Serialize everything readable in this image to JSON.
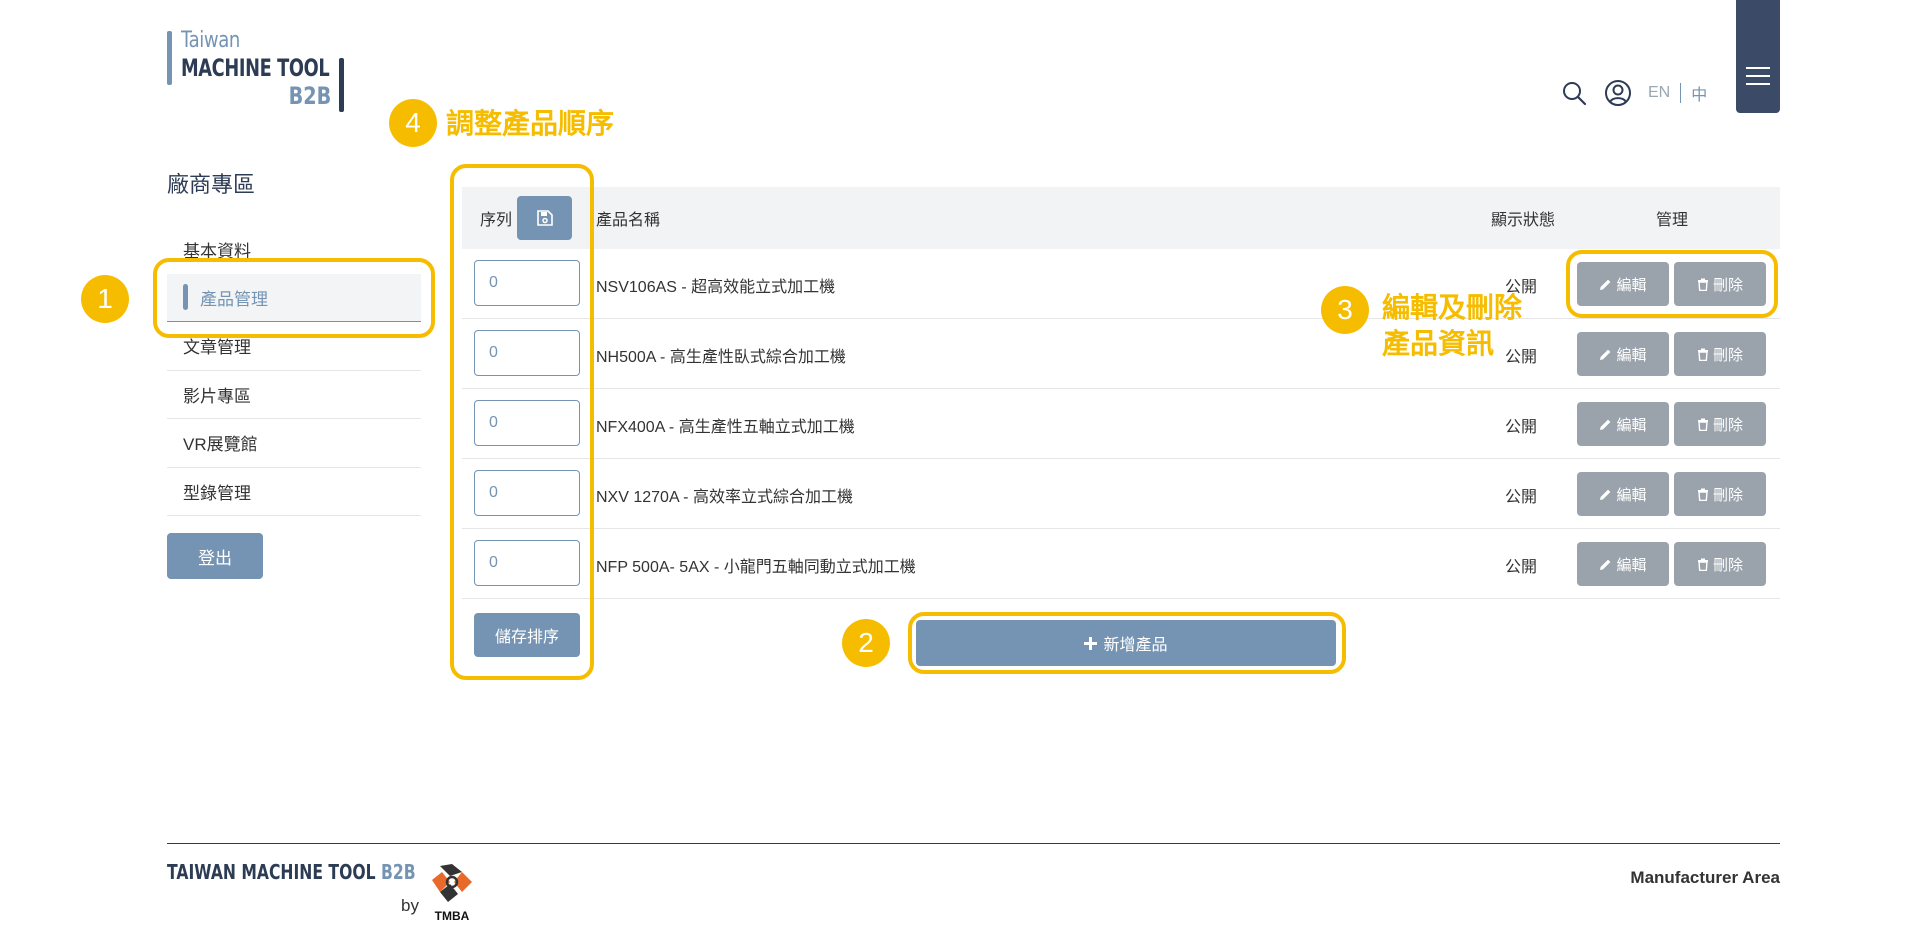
{
  "logo": {
    "line1": "Taiwan",
    "line2": "MACHINE TOOL",
    "line3": "B2B"
  },
  "header": {
    "lang_en": "EN",
    "lang_zh": "中",
    "search_icon": "search-icon",
    "user_icon": "user-icon",
    "menu_icon": "hamburger-menu-icon"
  },
  "sidebar": {
    "title": "廠商專區",
    "items": [
      {
        "label": "基本資料"
      },
      {
        "label": "產品管理",
        "active": true
      },
      {
        "label": "文章管理"
      },
      {
        "label": "影片專區"
      },
      {
        "label": "VR展覽館"
      },
      {
        "label": "型錄管理"
      }
    ],
    "logout": "登出"
  },
  "table": {
    "headers": {
      "seq": "序列",
      "name": "產品名稱",
      "status": "顯示狀態",
      "manage": "管理"
    },
    "rows": [
      {
        "seq": "0",
        "name": "NSV106AS - 超高效能立式加工機",
        "status": "公開",
        "edit": "編輯",
        "delete": "刪除"
      },
      {
        "seq": "0",
        "name": "NH500A - 高生產性臥式綜合加工機",
        "status": "公開",
        "edit": "編輯",
        "delete": "刪除"
      },
      {
        "seq": "0",
        "name": "NFX400A - 高生產性五軸立式加工機",
        "status": "公開",
        "edit": "編輯",
        "delete": "刪除"
      },
      {
        "seq": "0",
        "name": "NXV 1270A - 高效率立式綜合加工機",
        "status": "公開",
        "edit": "編輯",
        "delete": "刪除"
      },
      {
        "seq": "0",
        "name": "NFP 500A- 5AX - 小龍門五軸同動立式加工機",
        "status": "公開",
        "edit": "編輯",
        "delete": "刪除"
      }
    ],
    "save_order": "儲存排序",
    "add_product": "新增產品"
  },
  "annotations": {
    "n1": "1",
    "n2": "2",
    "n3": "3",
    "n4": "4",
    "t3_line1": "編輯及刪除",
    "t3_line2": "產品資訊",
    "t4": "調整產品順序"
  },
  "footer": {
    "brand": "TAIWAN MACHINE TOOL",
    "brand_b2b": "B2B",
    "by": "by",
    "tmba": "TMBA",
    "right": "Manufacturer Area"
  },
  "colors": {
    "primary": "#7594b3",
    "dark": "#2d3c55",
    "accent": "#f6bd00",
    "action_gray": "#9aa3ab"
  }
}
